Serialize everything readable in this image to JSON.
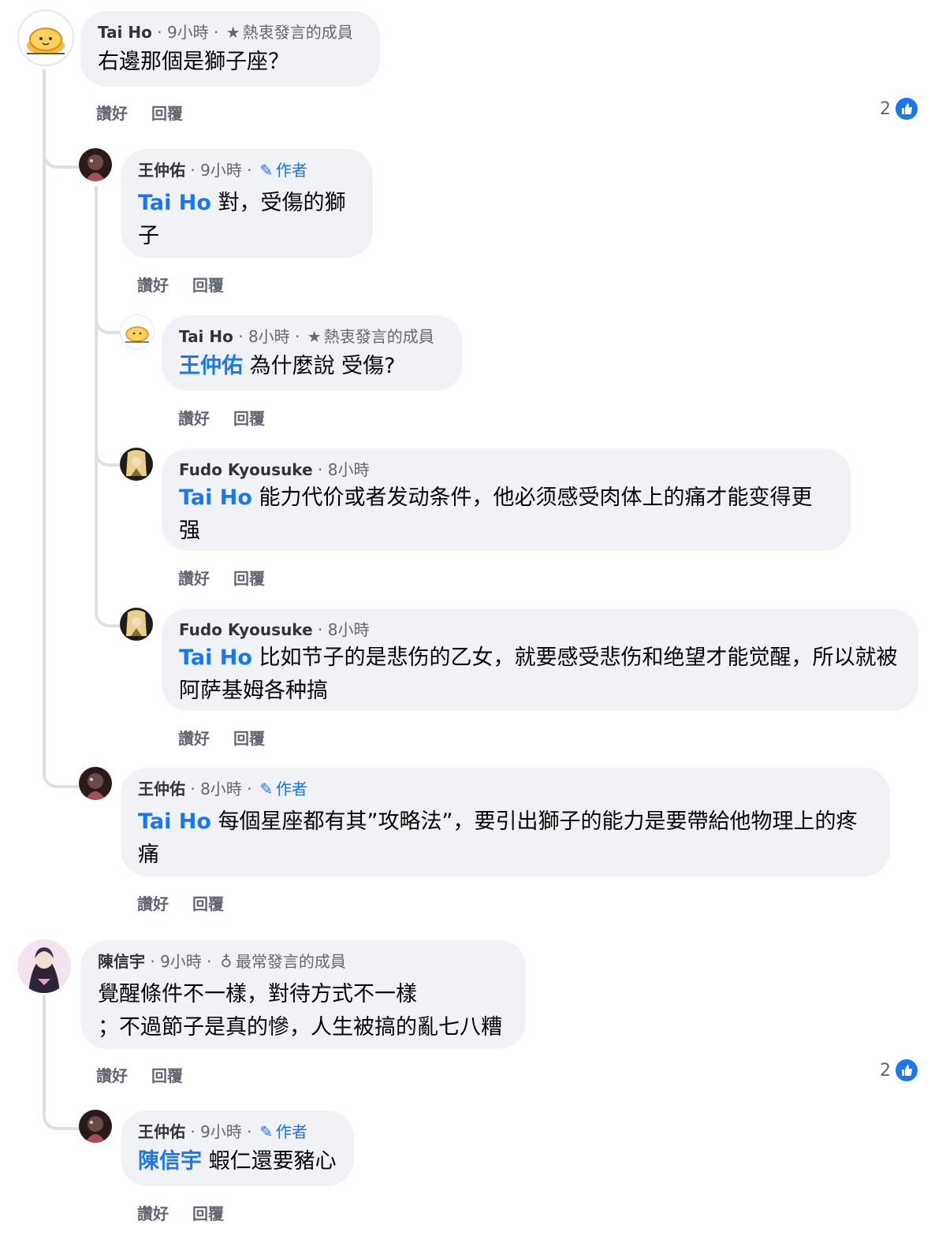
{
  "labels": {
    "like": "讚好",
    "reply": "回覆",
    "author": "作者"
  },
  "comments": [
    {
      "name": "Tai Ho",
      "time": "9小時",
      "badge": "熱衷發言的成員",
      "badge_icon": "star-icon",
      "mention": "",
      "text": "右邊那個是獅子座？",
      "likes": "2"
    },
    {
      "name": "王仲佑",
      "time": "9小時",
      "badge": "作者",
      "badge_icon": "pencil-icon",
      "mention": "Tai Ho",
      "text1": " 對，受傷的獅",
      "text2": "子"
    },
    {
      "name": "Tai Ho",
      "time": "8小時",
      "badge": "熱衷發言的成員",
      "badge_icon": "star-icon",
      "mention": "王仲佑",
      "text": " 為什麼說 受傷?"
    },
    {
      "name": "Fudo Kyousuke",
      "time": "8小時",
      "mention": "Tai Ho",
      "text1": " 能力代价或者发动条件，他必须感受肉体上的痛才能变得更",
      "text2": "强"
    },
    {
      "name": "Fudo Kyousuke",
      "time": "8小時",
      "mention": "Tai Ho",
      "text1": " 比如节子的是悲伤的乙女，就要感受悲伤和绝望才能觉醒，所以就被",
      "text2": "阿萨基姆各种搞"
    },
    {
      "name": "王仲佑",
      "time": "8小時",
      "badge": "作者",
      "badge_icon": "pencil-icon",
      "mention": "Tai Ho",
      "text1": " 每個星座都有其”攻略法”，要引出獅子的能力是要帶給他物理上的疼",
      "text2": "痛"
    },
    {
      "name": "陳信宇",
      "time": "9小時",
      "badge": "最常發言的成員",
      "badge_icon": "award-icon",
      "text1": "覺醒條件不一樣，對待方式不一樣",
      "text2": "；不過節子是真的慘，人生被搞的亂七八糟",
      "likes": "2"
    },
    {
      "name": "王仲佑",
      "time": "9小時",
      "badge": "作者",
      "badge_icon": "pencil-icon",
      "mention": "陳信宇",
      "text": " 蝦仁還要豬心"
    }
  ]
}
